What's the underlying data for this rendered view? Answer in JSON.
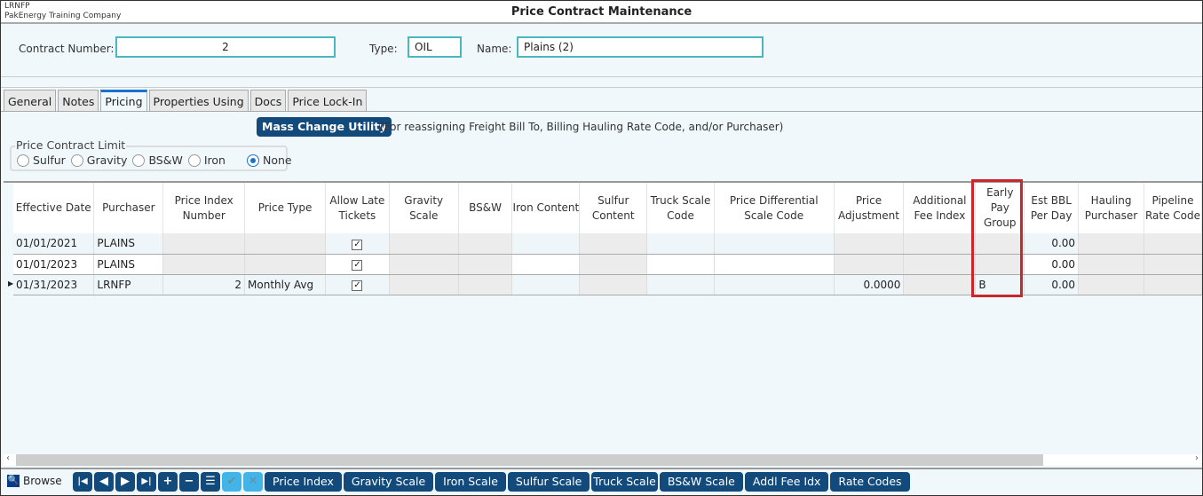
{
  "header": {
    "company_code": "LRNFP",
    "company_name": "PakEnergy Training Company",
    "title": "Price Contract Maintenance"
  },
  "form": {
    "contract_number_label": "Contract Number:",
    "contract_number": "2",
    "type_label": "Type:",
    "type": "OIL",
    "name_label": "Name:",
    "name": "Plains (2)"
  },
  "tabs": [
    {
      "label": "General"
    },
    {
      "label": "Notes"
    },
    {
      "label": "Pricing",
      "active": true
    },
    {
      "label": "Properties Using"
    },
    {
      "label": "Docs"
    },
    {
      "label": "Price Lock-In"
    }
  ],
  "mass_change": {
    "label": "Mass Change Utility",
    "note": "(For reassigning Freight Bill To, Billing Hauling Rate Code, and/or Purchaser)"
  },
  "limit": {
    "title": "Price Contract Limit",
    "options": [
      "Sulfur",
      "Gravity",
      "BS&W",
      "Iron",
      "None"
    ],
    "selected": "None"
  },
  "grid": {
    "columns": [
      "Effective Date",
      "Purchaser",
      "Price Index Number",
      "Price Type",
      "Allow Late Tickets",
      "Gravity Scale",
      "BS&W",
      "Iron Content",
      "Sulfur Content",
      "Truck Scale Code",
      "Price Differential Scale Code",
      "Price Adjustment",
      "Additional Fee Index",
      "Early Pay Group",
      "Est BBL Per Day",
      "Hauling Purchaser",
      "Pipeline Rate Code"
    ],
    "rows": [
      [
        "01/01/2021",
        "PLAINS",
        "",
        "",
        "✓",
        "",
        "",
        "",
        "",
        "",
        "",
        "",
        "",
        "",
        "0.00",
        "",
        ""
      ],
      [
        "01/01/2023",
        "PLAINS",
        "",
        "",
        "✓",
        "",
        "",
        "",
        "",
        "",
        "",
        "",
        "",
        "",
        "0.00",
        "",
        ""
      ],
      [
        "01/31/2023",
        "LRNFP",
        "2",
        "Monthly Avg",
        "✓",
        "",
        "",
        "",
        "",
        "",
        "",
        "0.0000",
        "",
        "B",
        "0.00",
        "",
        ""
      ]
    ],
    "current_row": 2,
    "highlight_color": "#c8282c"
  },
  "footer": {
    "browse_label": "Browse",
    "nav_icons": [
      "first-icon",
      "prev-icon",
      "next-icon",
      "last-icon",
      "add-icon",
      "delete-icon",
      "list-icon",
      "save-icon",
      "cancel-icon"
    ],
    "buttons": [
      "Price Index",
      "Gravity Scale",
      "Iron Scale",
      "Sulfur Scale",
      "Truck Scale",
      "BS&W Scale",
      "Addl Fee Idx",
      "Rate Codes"
    ]
  }
}
